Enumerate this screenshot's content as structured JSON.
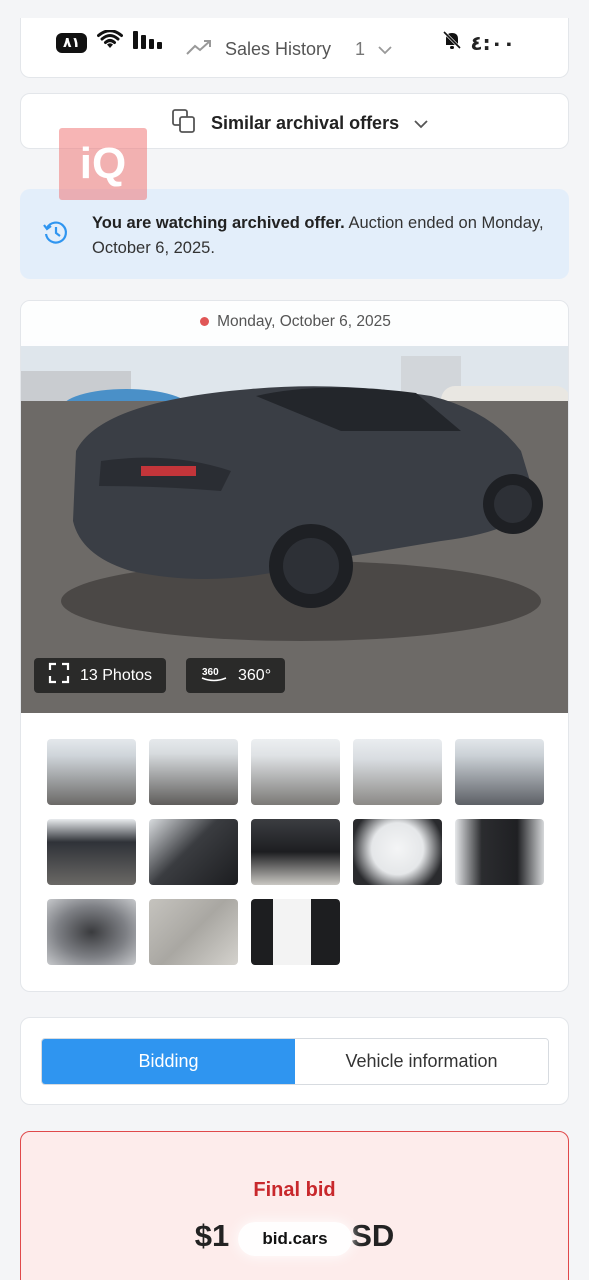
{
  "status_bar": {
    "battery": "٨١",
    "time": "٤:٠٠",
    "icons": [
      "wifi-icon",
      "signal-icon",
      "bell-muted-icon"
    ]
  },
  "sales_history": {
    "label": "Sales History",
    "count": "1",
    "icons": [
      "trend-up-icon",
      "chevron-down-icon"
    ]
  },
  "similar": {
    "label": "Similar archival offers",
    "icons": [
      "copy-icon",
      "chevron-down-icon"
    ]
  },
  "watermark": "iQ",
  "notice": {
    "bold": "You are watching archived offer.",
    "text": " Auction ended on Monday, October 6, 2025.",
    "icon": "history-icon"
  },
  "gallery": {
    "date": "Monday, October 6, 2025",
    "photos_label": "13 Photos",
    "view_360_label": "360°",
    "view_360_badge": "360",
    "thumbnails": [
      "exterior-rear-left",
      "exterior-rear-right",
      "exterior-side",
      "exterior-damage-side",
      "exterior-front",
      "exterior-rear",
      "interior-front",
      "interior-console",
      "interior-screen",
      "interior-rear-seats",
      "frunk",
      "part",
      "label"
    ]
  },
  "tabs": [
    {
      "label": "Bidding",
      "active": true
    },
    {
      "label": "Vehicle information",
      "active": false
    }
  ],
  "final_bid": {
    "title": "Final bid",
    "amount_prefix": "$1",
    "amount_suffix": "SD",
    "pill_label": "bid.cars"
  },
  "colors": {
    "accent": "#2f95f0",
    "notice_bg": "#e3eefa",
    "bid_border": "#e0494a",
    "bid_title": "#c8282c"
  }
}
